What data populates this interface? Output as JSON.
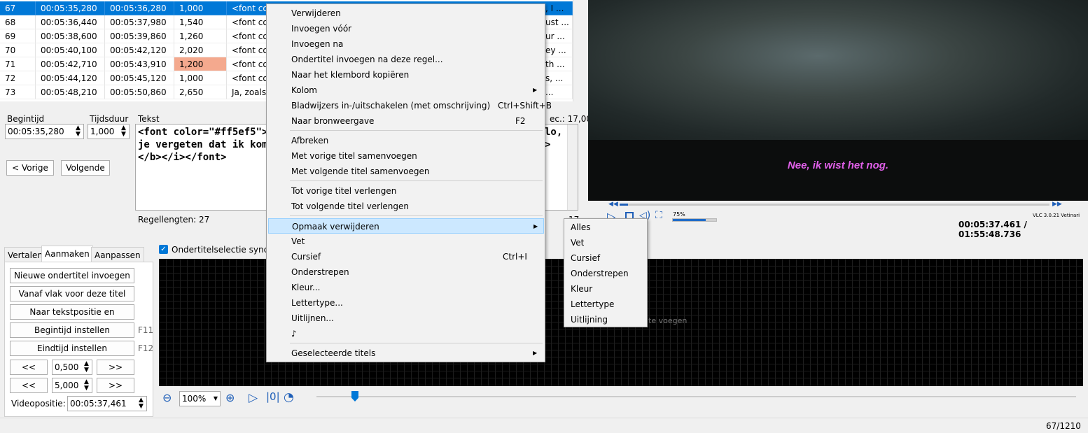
{
  "grid": {
    "rows": [
      {
        "nr": "67",
        "start": "00:05:35,280",
        "end": "00:05:36,280",
        "dur": "1,000",
        "text": "<font co",
        "tail": ", I ...",
        "selected": true
      },
      {
        "nr": "68",
        "start": "00:05:36,440",
        "end": "00:05:37,980",
        "dur": "1,540",
        "text": "<font co",
        "tail": "ust ..."
      },
      {
        "nr": "69",
        "start": "00:05:38,600",
        "end": "00:05:39,860",
        "dur": "1,260",
        "text": "<font co",
        "tail": "ur ..."
      },
      {
        "nr": "70",
        "start": "00:05:40,100",
        "end": "00:05:42,120",
        "dur": "2,020",
        "text": "<font co",
        "tail": "ey ..."
      },
      {
        "nr": "71",
        "start": "00:05:42,710",
        "end": "00:05:43,910",
        "dur": "1,200",
        "text": "<font co",
        "tail": "th ...",
        "warn": true
      },
      {
        "nr": "72",
        "start": "00:05:44,120",
        "end": "00:05:45,120",
        "dur": "1,000",
        "text": "<font co",
        "tail": "s, ..."
      },
      {
        "nr": "73",
        "start": "00:05:48,210",
        "end": "00:05:50,860",
        "dur": "2,650",
        "text": "Ja, zoals",
        "tail": "..."
      }
    ]
  },
  "edit": {
    "begintijd_label": "Begintijd",
    "begintijd_value": "00:05:35,280",
    "tijdsduur_label": "Tijdsduur",
    "tijdsduur_value": "1,000",
    "tekst_label": "Tekst",
    "cps_label": "ec.: 17,00",
    "prev_button": "< Vorige",
    "next_button": "Volgende",
    "text_line1": "<font color=\"#ff5ef5\">",
    "text_line1_tail": "lo,",
    "text_line2": "je vergeten dat ik kom",
    "text_line2_tail": ">",
    "text_line3": "</b></i></font>",
    "regellengten": "Regellengten: 27",
    "regel_tail": "17"
  },
  "video": {
    "subtitle": "Nee, ik wist het nog.",
    "volume": "75%",
    "vlc_version": "VLC 3.0.21 Vetinari",
    "position": "00:05:37.461 / 01:55:48.736",
    "progress": 0.02,
    "volume_level": 0.75
  },
  "sync_checkbox": "Ondertitelselectie synchro",
  "tabs": [
    "Vertalen",
    "Aanmaken",
    "Aanpassen"
  ],
  "panel": {
    "new_sub": "Nieuwe ondertitel invoegen",
    "from_region": "Vanaf vlak voor deze titel",
    "goto_pause": "Naar tekstpositie en pauzeren",
    "set_start": "Begintijd instellen",
    "set_start_key": "F11",
    "set_end": "Eindtijd instellen",
    "set_end_key": "F12",
    "back": "<<",
    "fwd": ">>",
    "step1": "0,500",
    "step2": "5,000",
    "videopos_label": "Videopositie:",
    "videopos_value": "00:05:37,461"
  },
  "waveform": {
    "zoom": "100%",
    "hint": "te voegen"
  },
  "status_count": "67/1210",
  "context_menu": {
    "items": [
      {
        "label": "Verwijderen"
      },
      {
        "label": "Invoegen vóór"
      },
      {
        "label": "Invoegen na"
      },
      {
        "label": "Ondertitel invoegen na deze regel..."
      },
      {
        "label": "Naar het klembord kopiëren"
      },
      {
        "label": "Kolom",
        "submenu": true
      },
      {
        "label": "Bladwijzers in-/uitschakelen (met omschrijving)",
        "shortcut": "Ctrl+Shift+B"
      },
      {
        "label": "Naar bronweergave",
        "shortcut": "F2"
      },
      {
        "label": "Afbreken"
      },
      {
        "label": "Met vorige titel samenvoegen"
      },
      {
        "label": "Met volgende titel samenvoegen"
      },
      {
        "label": "Tot vorige titel verlengen"
      },
      {
        "label": "Tot volgende titel verlengen"
      },
      {
        "label": "Opmaak verwijderen",
        "submenu": true,
        "highlighted": true
      },
      {
        "label": "Vet"
      },
      {
        "label": "Cursief",
        "shortcut": "Ctrl+I"
      },
      {
        "label": "Onderstrepen"
      },
      {
        "label": "Kleur..."
      },
      {
        "label": "Lettertype..."
      },
      {
        "label": "Uitlijnen..."
      },
      {
        "label": "♪"
      },
      {
        "label": "Geselecteerde titels",
        "submenu": true
      }
    ]
  },
  "submenu": {
    "items": [
      "Alles",
      "Vet",
      "Cursief",
      "Onderstrepen",
      "Kleur",
      "Lettertype",
      "Uitlijning"
    ]
  },
  "colors": {
    "selection": "#0078d7",
    "warn_cell": "#f4a98e",
    "subtitle": "#e060e8",
    "menu_highlight": "#cce8ff"
  }
}
